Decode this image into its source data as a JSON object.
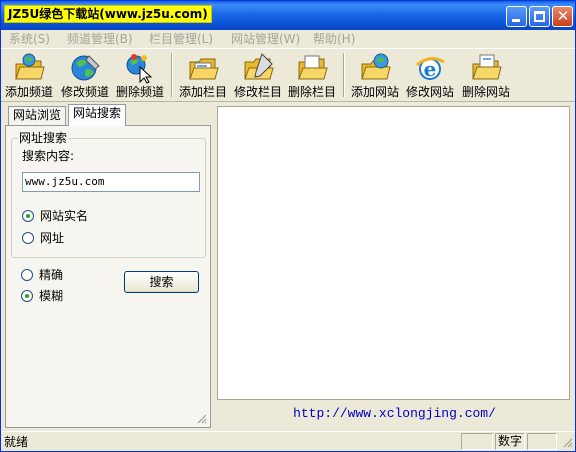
{
  "window": {
    "title": "JZ5U绿色下载站(www.jz5u.com)",
    "controls": {
      "minimize_icon": "minimize-icon",
      "maximize_icon": "maximize-icon",
      "close_icon": "close-icon"
    }
  },
  "menu": [
    {
      "label": "系统(S)"
    },
    {
      "label": "频道管理(B)"
    },
    {
      "label": "栏目管理(L)"
    },
    {
      "label": "网站管理(W)"
    },
    {
      "label": "帮助(H)"
    }
  ],
  "toolbar": [
    {
      "label": "添加频道",
      "icon": "add-channel-icon"
    },
    {
      "label": "修改频道",
      "icon": "edit-channel-icon"
    },
    {
      "label": "删除频道",
      "icon": "delete-channel-icon"
    },
    {
      "label": "添加栏目",
      "icon": "add-column-icon"
    },
    {
      "label": "修改栏目",
      "icon": "edit-column-icon"
    },
    {
      "label": "删除栏目",
      "icon": "delete-column-icon"
    },
    {
      "label": "添加网站",
      "icon": "add-site-icon"
    },
    {
      "label": "修改网站",
      "icon": "edit-site-icon"
    },
    {
      "label": "删除网站",
      "icon": "delete-site-icon"
    }
  ],
  "tabs": [
    {
      "label": "网站浏览",
      "active": false
    },
    {
      "label": "网站搜索",
      "active": true
    }
  ],
  "search": {
    "group_title": "网址搜索",
    "content_label": "搜索内容:",
    "content_value": "www.jz5u.com",
    "field_options": [
      {
        "label": "网站实名",
        "checked": true
      },
      {
        "label": "网址",
        "checked": false
      }
    ],
    "match_options": [
      {
        "label": "精确",
        "checked": false
      },
      {
        "label": "模糊",
        "checked": true
      }
    ],
    "search_button": "搜索"
  },
  "footer_link": "http://www.xclongjing.com/",
  "status": {
    "main": "就绪",
    "panels": [
      "",
      "数字",
      ""
    ]
  },
  "colors": {
    "title_bg": "#0b52d4",
    "title_label_bg": "#ffff00",
    "window_bg": "#ece9d8",
    "link": "#0000c0",
    "menu_disabled": "#a6a39a"
  }
}
